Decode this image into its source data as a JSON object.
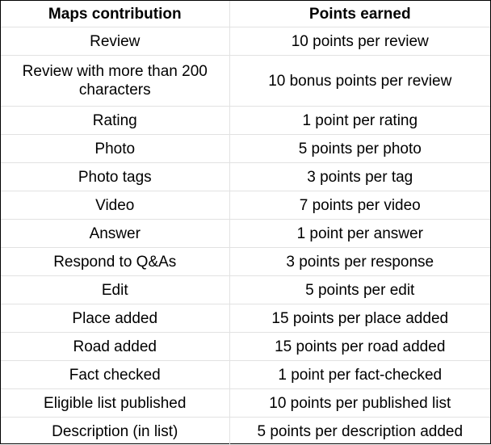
{
  "table": {
    "headers": [
      "Maps contribution",
      "Points earned"
    ],
    "rows": [
      [
        "Review",
        "10 points per review"
      ],
      [
        "Review with more than 200 characters",
        "10 bonus points per review"
      ],
      [
        "Rating",
        "1 point per rating"
      ],
      [
        "Photo",
        "5 points per photo"
      ],
      [
        "Photo tags",
        "3 points per tag"
      ],
      [
        "Video",
        "7 points per video"
      ],
      [
        "Answer",
        "1 point per answer"
      ],
      [
        "Respond to Q&As",
        "3 points per response"
      ],
      [
        "Edit",
        "5 points per edit"
      ],
      [
        "Place added",
        "15 points per place added"
      ],
      [
        "Road added",
        "15 points per road added"
      ],
      [
        "Fact checked",
        "1 point per fact-checked"
      ],
      [
        "Eligible list published",
        "10 points per published list"
      ],
      [
        "Description (in list)",
        "5 points per description added"
      ]
    ]
  }
}
